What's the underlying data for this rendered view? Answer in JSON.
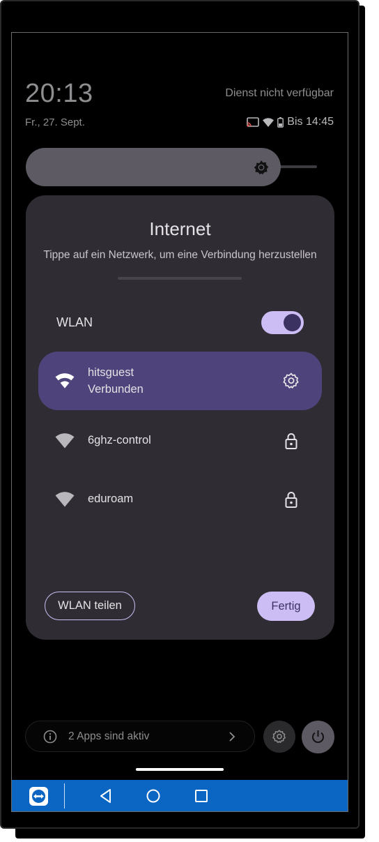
{
  "status": {
    "time": "20:13",
    "service": "Dienst nicht verfügbar",
    "date": "Fr., 27. Sept.",
    "battery_text": "Bis 14:45"
  },
  "brightness": {
    "level": 0.85
  },
  "dialog": {
    "title": "Internet",
    "subtitle": "Tippe auf ein Netzwerk, um eine Verbindung herzustellen",
    "wlan_label": "WLAN",
    "wlan_enabled": true,
    "networks": [
      {
        "name": "hitsguest",
        "status": "Verbunden",
        "icon": "wifi-icon",
        "action_icon": "gear-icon"
      },
      {
        "name": "6ghz-control",
        "status": "",
        "icon": "wifi-icon",
        "action_icon": "lock-icon"
      },
      {
        "name": "eduroam",
        "status": "",
        "icon": "wifi-icon",
        "action_icon": "lock-icon"
      }
    ],
    "share_button": "WLAN teilen",
    "done_button": "Fertig"
  },
  "footer": {
    "active_apps": "2 Apps sind aktiv"
  },
  "colors": {
    "accent": "#cdbdf5",
    "connected_bg": "#4e437a",
    "dialog_bg": "#2f2d33",
    "navbar": "#0b65c2"
  }
}
